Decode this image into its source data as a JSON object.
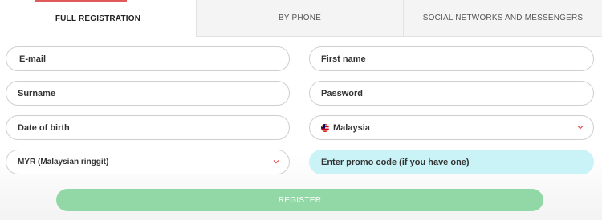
{
  "tabs": [
    {
      "label": "FULL REGISTRATION"
    },
    {
      "label": "BY PHONE"
    },
    {
      "label": "SOCIAL NETWORKS AND MESSENGERS"
    }
  ],
  "form": {
    "email_placeholder": "E-mail",
    "first_name_placeholder": "First name",
    "surname_placeholder": "Surname",
    "password_placeholder": "Password",
    "dob_placeholder": "Date of birth",
    "country_value": "Malaysia",
    "currency_value": "MYR (Malaysian ringgit)",
    "promo_placeholder": "Enter promo code (if you have one)",
    "register_label": "REGISTER"
  },
  "icons": {
    "country_flag": "malaysia-flag-icon",
    "dropdown": "chevron-down-icon"
  },
  "colors": {
    "active_tab_accent": "#e05a5a",
    "register_button": "#92d8a6",
    "promo_field": "#c9f3f6",
    "chevron": "#e05a5a"
  }
}
